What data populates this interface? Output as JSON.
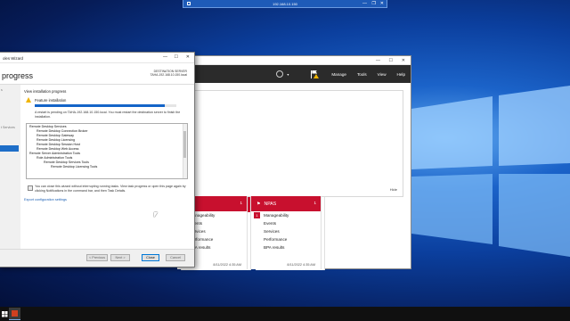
{
  "remote_bar": {
    "host": "192.168.10.150"
  },
  "server_manager": {
    "menu": {
      "manage": "Manage",
      "tools": "Tools",
      "view": "View",
      "help": "Help"
    },
    "notif_hide": "Hide",
    "tiles": [
      {
        "title": "",
        "count": "1",
        "rows": [
          "Manageability",
          "Events",
          "Services",
          "Performance",
          "BPA results"
        ],
        "timestamp": "8/11/2022 4:35 AM"
      },
      {
        "title": "",
        "count": "",
        "rows": [
          "Events",
          "Services",
          "Performance",
          "BPA results"
        ],
        "timestamp": "8/11/2022 4:35 AM"
      },
      {
        "title": "",
        "count": "1",
        "rows": [
          "Manageability",
          "Events",
          "Services",
          "Performance",
          "BPA results"
        ],
        "timestamp": "8/11/2022 4:35 AM"
      },
      {
        "title": "NPAS",
        "count": "1",
        "rows": [
          "Manageability",
          "Events",
          "Services",
          "Performance",
          "BPA results"
        ],
        "timestamp": "8/11/2022 4:35 AM"
      }
    ]
  },
  "wizard": {
    "window_title": "oles Wizard",
    "page_title": "progress",
    "dest_label": "DESTINATION SERVER",
    "dest_server": "TAHA-192.168.10.150.local",
    "nav_items": [
      "s",
      "t Services"
    ],
    "view_progress": "View installation progress",
    "feature_install": "Feature installation",
    "progress": 0.92,
    "restart_note": "A restart is pending on TAHA-192.168.10.150.local. You must restart the destination server to finish the installation.",
    "items": [
      {
        "indent": 0,
        "text": "Remote Desktop Services"
      },
      {
        "indent": 1,
        "text": "Remote Desktop Connection Broker"
      },
      {
        "indent": 1,
        "text": "Remote Desktop Gateway"
      },
      {
        "indent": 1,
        "text": "Remote Desktop Licensing"
      },
      {
        "indent": 1,
        "text": "Remote Desktop Session Host"
      },
      {
        "indent": 1,
        "text": "Remote Desktop Web Access"
      },
      {
        "indent": 0,
        "text": "Remote Server Administration Tools"
      },
      {
        "indent": 1,
        "text": "Role Administration Tools"
      },
      {
        "indent": 2,
        "text": "Remote Desktop Services Tools"
      },
      {
        "indent": 3,
        "text": "Remote Desktop Licensing Tools"
      }
    ],
    "close_note": "You can close this wizard without interrupting running tasks. View task progress or open this page again by clicking Notifications in the command bar, and then Task Details.",
    "export_link": "Export configuration settings",
    "buttons": {
      "previous": "< Previous",
      "next": "Next >",
      "close": "Close",
      "cancel": "Cancel"
    }
  }
}
